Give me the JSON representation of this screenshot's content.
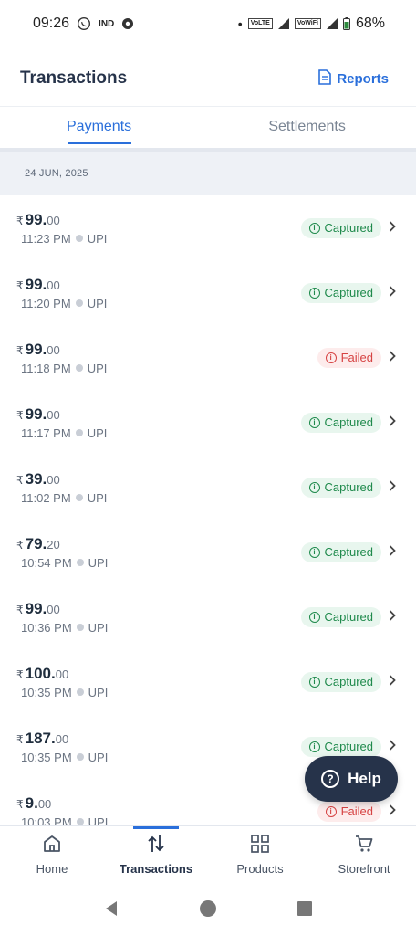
{
  "status_bar": {
    "time": "09:26",
    "carrier": "IND",
    "badge1": "VoLTE",
    "badge2": "VoWiFi",
    "battery": "68%"
  },
  "header": {
    "title": "Transactions",
    "reports_label": "Reports"
  },
  "tabs": [
    {
      "label": "Payments",
      "active": true
    },
    {
      "label": "Settlements",
      "active": false
    }
  ],
  "date_header": "24 JUN, 2025",
  "transactions": [
    {
      "rupee": "₹",
      "int": "99.",
      "dec": "00",
      "time": "11:23 PM",
      "method": "UPI",
      "status": "Captured",
      "status_type": "captured"
    },
    {
      "rupee": "₹",
      "int": "99.",
      "dec": "00",
      "time": "11:20 PM",
      "method": "UPI",
      "status": "Captured",
      "status_type": "captured"
    },
    {
      "rupee": "₹",
      "int": "99.",
      "dec": "00",
      "time": "11:18 PM",
      "method": "UPI",
      "status": "Failed",
      "status_type": "failed"
    },
    {
      "rupee": "₹",
      "int": "99.",
      "dec": "00",
      "time": "11:17 PM",
      "method": "UPI",
      "status": "Captured",
      "status_type": "captured"
    },
    {
      "rupee": "₹",
      "int": "39.",
      "dec": "00",
      "time": "11:02 PM",
      "method": "UPI",
      "status": "Captured",
      "status_type": "captured"
    },
    {
      "rupee": "₹",
      "int": "79.",
      "dec": "20",
      "time": "10:54 PM",
      "method": "UPI",
      "status": "Captured",
      "status_type": "captured"
    },
    {
      "rupee": "₹",
      "int": "99.",
      "dec": "00",
      "time": "10:36 PM",
      "method": "UPI",
      "status": "Captured",
      "status_type": "captured"
    },
    {
      "rupee": "₹",
      "int": "100.",
      "dec": "00",
      "time": "10:35 PM",
      "method": "UPI",
      "status": "Captured",
      "status_type": "captured"
    },
    {
      "rupee": "₹",
      "int": "187.",
      "dec": "00",
      "time": "10:35 PM",
      "method": "UPI",
      "status": "Captured",
      "status_type": "captured"
    },
    {
      "rupee": "₹",
      "int": "9.",
      "dec": "00",
      "time": "10:03 PM",
      "method": "UPI",
      "status": "Failed",
      "status_type": "failed"
    }
  ],
  "help": {
    "label": "Help",
    "icon_char": "?"
  },
  "bottom_nav": [
    {
      "label": "Home",
      "icon": "home-icon",
      "active": false
    },
    {
      "label": "Transactions",
      "icon": "transactions-icon",
      "active": true
    },
    {
      "label": "Products",
      "icon": "grid-icon",
      "active": false
    },
    {
      "label": "Storefront",
      "icon": "cart-icon",
      "active": false
    }
  ],
  "colors": {
    "accent": "#2a6fdb",
    "captured_bg": "#e8f6ee",
    "captured_fg": "#1f8a4c",
    "failed_bg": "#fdecec",
    "failed_fg": "#d64343",
    "dark": "#26334a"
  }
}
